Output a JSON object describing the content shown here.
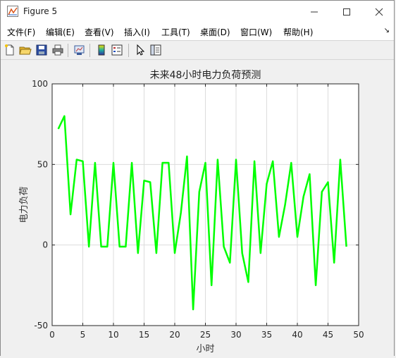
{
  "window": {
    "title": "Figure 5"
  },
  "menu": {
    "items": [
      "文件(F)",
      "编辑(E)",
      "查看(V)",
      "插入(I)",
      "工具(T)",
      "桌面(D)",
      "窗口(W)",
      "帮助(H)"
    ],
    "overflow_icon": "menu-overflow-arrow"
  },
  "toolbar": {
    "icons": [
      "new-figure-icon",
      "open-file-icon",
      "save-icon",
      "print-icon",
      "link-plot-icon",
      "insert-colorbar-icon",
      "insert-legend-icon",
      "pointer-icon",
      "property-inspector-icon"
    ]
  },
  "chart_data": {
    "type": "line",
    "title": "未来48小时电力负荷预测",
    "xlabel": "小时",
    "ylabel": "电力负荷",
    "xlim": [
      0,
      50
    ],
    "ylim": [
      -50,
      100
    ],
    "xticks": [
      0,
      5,
      10,
      15,
      20,
      25,
      30,
      35,
      40,
      45,
      50
    ],
    "yticks": [
      -50,
      0,
      50,
      100
    ],
    "grid": true,
    "series": [
      {
        "color": "#00ff00",
        "x": [
          1,
          2,
          3,
          4,
          5,
          6,
          7,
          8,
          9,
          10,
          11,
          12,
          13,
          14,
          15,
          16,
          17,
          18,
          19,
          20,
          21,
          22,
          23,
          24,
          25,
          26,
          27,
          28,
          29,
          30,
          31,
          32,
          33,
          34,
          35,
          36,
          37,
          38,
          39,
          40,
          41,
          42,
          43,
          44,
          45,
          46,
          47,
          48
        ],
        "y": [
          72,
          80,
          19,
          53,
          52,
          -1,
          51,
          -1,
          -1,
          51,
          -1,
          -1,
          51,
          -5,
          40,
          39,
          -5,
          51,
          51,
          -5,
          20,
          55,
          -40,
          33,
          51,
          -25,
          53,
          -1,
          -11,
          53,
          -5,
          -23,
          52,
          -5,
          38,
          52,
          5,
          25,
          51,
          5,
          30,
          44,
          -25,
          33,
          39,
          -11,
          53,
          -1
        ]
      }
    ]
  }
}
